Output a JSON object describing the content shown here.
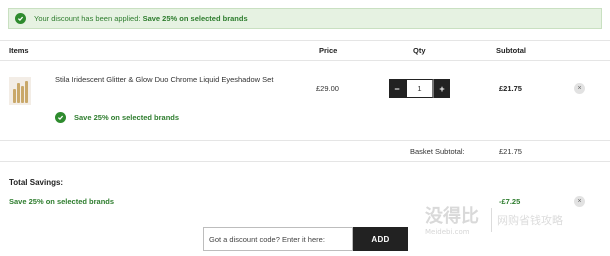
{
  "banner": {
    "prefix": "Your discount has been applied:",
    "highlight": "Save 25% on selected brands"
  },
  "table": {
    "headers": {
      "items": "Items",
      "price": "Price",
      "qty": "Qty",
      "subtotal": "Subtotal"
    }
  },
  "item": {
    "name": "Stila Iridescent Glitter & Glow Duo Chrome Liquid Eyeshadow Set",
    "price": "£29.00",
    "quantity": "1",
    "minus_label": "−",
    "plus_label": "+",
    "subtotal": "£21.75",
    "promo": "Save 25% on selected brands",
    "remove_label": "×"
  },
  "basket": {
    "label": "Basket Subtotal:",
    "value": "£21.75"
  },
  "savings": {
    "heading": "Total Savings:",
    "item_label": "Save 25% on selected brands",
    "item_value": "-£7.25",
    "remove_label": "×"
  },
  "discount": {
    "placeholder": "Got a discount code? Enter it here:",
    "button_label": "ADD"
  },
  "watermark": {
    "logo": "没得比",
    "tagline": "网购省钱攻略",
    "url": "Meidebi.com"
  },
  "colors": {
    "accent_green": "#2e7d2e",
    "banner_bg": "#e6f2e2",
    "dark": "#222222"
  },
  "icons": {
    "check": "check-circle-icon",
    "remove": "close-icon"
  }
}
